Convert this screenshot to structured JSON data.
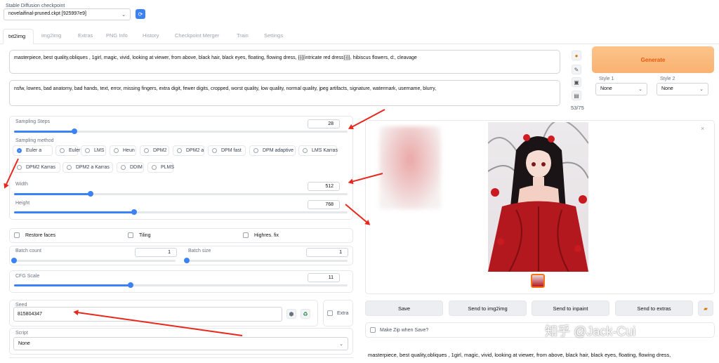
{
  "checkpoint": {
    "label": "Stable Diffusion checkpoint",
    "value": "novelaifinal-pruned.ckpt [925997e9]"
  },
  "tabs": [
    "txt2img",
    "img2img",
    "Extras",
    "PNG Info",
    "History",
    "Checkpoint Merger",
    "Train",
    "Settings"
  ],
  "prompt": "masterpiece, best quality,obliques , 1girl, magic, vivid, looking at viewer, from above, black hair, black eyes, floating, flowing dress, {{{{intricate red dress}}}}, hibiscus flowers, d:, cleavage",
  "negative_prompt": "nsfw, lowres, bad anatomy, bad hands, text, error, missing fingers, extra digit, fewer digits, cropped, worst quality, low quality, normal quality, jpeg artifacts, signature, watermark, username, blurry,",
  "token_count": "53/75",
  "generate_label": "Generate",
  "style1": {
    "label": "Style 1",
    "value": "None"
  },
  "style2": {
    "label": "Style 2",
    "value": "None"
  },
  "sampling_steps": {
    "label": "Sampling Steps",
    "value": "28",
    "fraction": 0.18
  },
  "sampling_method": {
    "label": "Sampling method",
    "options": [
      "Euler a",
      "Euler",
      "LMS",
      "Heun",
      "DPM2",
      "DPM2 a",
      "DPM fast",
      "DPM adaptive",
      "LMS Karras",
      "DPM2 Karras",
      "DPM2 a Karras",
      "DDIM",
      "PLMS"
    ],
    "selected": "Euler a"
  },
  "width": {
    "label": "Width",
    "value": "512",
    "fraction": 0.23
  },
  "height": {
    "label": "Height",
    "value": "768",
    "fraction": 0.36
  },
  "checkboxes": {
    "restore_faces": "Restore faces",
    "tiling": "Tiling",
    "highres_fix": "Highres. fix"
  },
  "batch_count": {
    "label": "Batch count",
    "value": "1",
    "fraction": 0.0
  },
  "batch_size": {
    "label": "Batch size",
    "value": "1",
    "fraction": 0.0
  },
  "cfg_scale": {
    "label": "CFG Scale",
    "value": "11",
    "fraction": 0.35
  },
  "seed": {
    "label": "Seed",
    "value": "815804347"
  },
  "extra_label": "Extra",
  "script": {
    "label": "Script",
    "value": "None"
  },
  "output_buttons": [
    "Save",
    "Send to img2img",
    "Send to inpaint",
    "Send to extras"
  ],
  "make_zip_label": "Make Zip when Save?",
  "output_info": "masterpiece, best quality,obliques , 1girl, magic, vivid, looking at viewer, from above, black hair, black eyes, floating, flowing dress,",
  "watermark": "知乎 @Jack-Cui",
  "colors": {
    "accent": "#3b82f6",
    "generate": "#fbbf7f",
    "arrow": "#e8281d"
  }
}
